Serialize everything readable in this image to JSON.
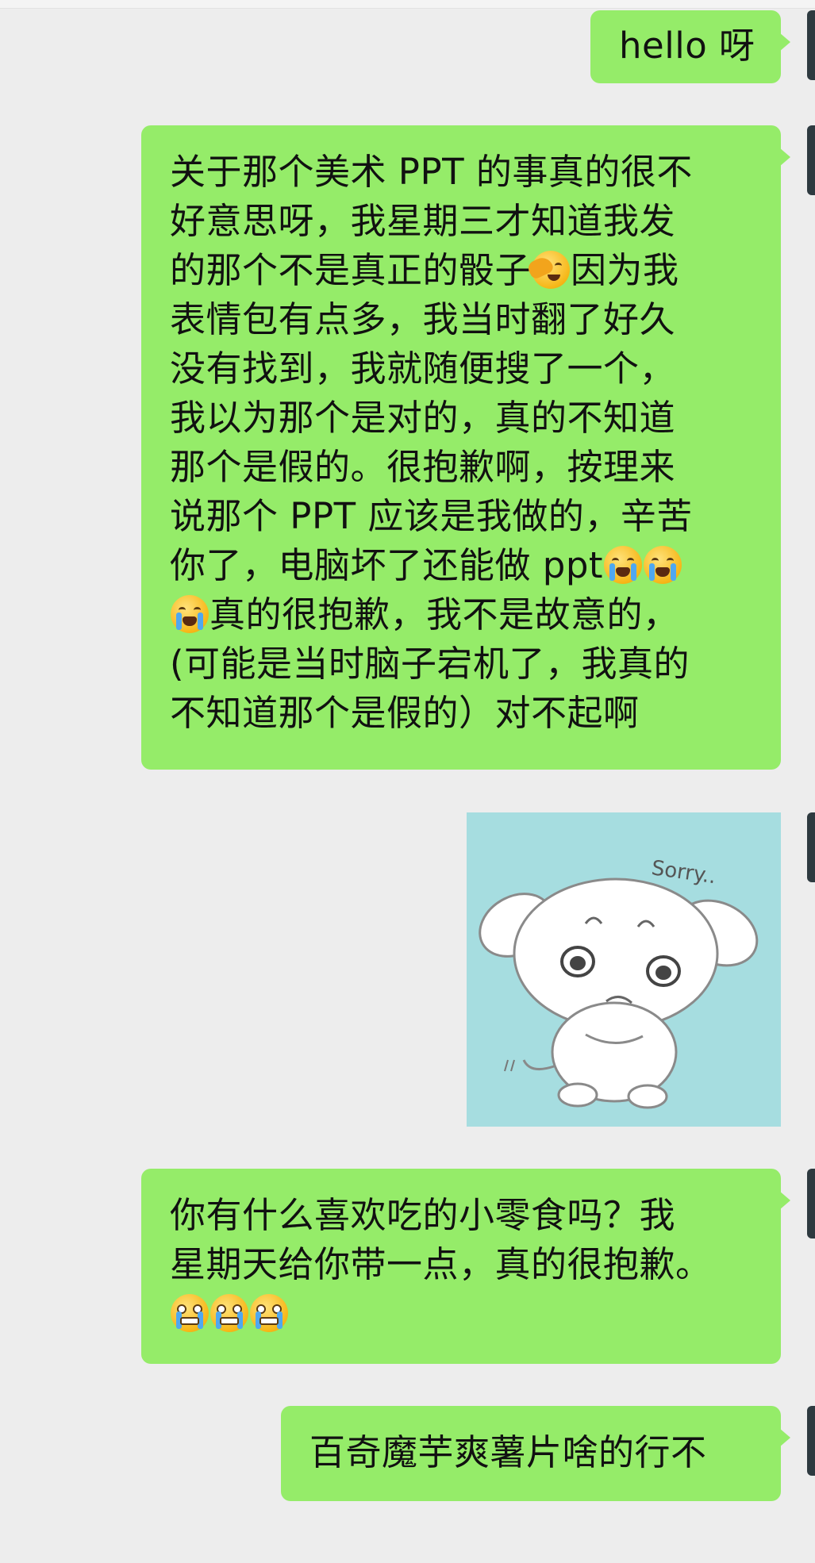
{
  "messages": [
    {
      "type": "text",
      "text": "hello 呀"
    },
    {
      "type": "rich",
      "lines": [
        "关于那个美术 PPT 的事真的很不",
        "好意思呀，我星期三才知道我发",
        "的那个不是真正的骰子",
        "表情包有点多，我当时翻了好久",
        "没有找到，我就随便搜了一个，",
        "我以为那个是对的，真的不知道",
        "那个是假的。很抱歉啊，按理来",
        "说那个 PPT 应该是我做的，辛苦",
        "你了，电脑坏了还能做 ppt",
        "真的很抱歉，我不是故意的，",
        "(可能是当时脑子宕机了，我真的",
        "不知道那个是假的）对不起啊"
      ],
      "line3_tail": "因为我",
      "emojis": [
        "facepalm-emoji",
        "crying-emoji",
        "crying-emoji",
        "crying-emoji"
      ]
    },
    {
      "type": "sticker",
      "caption": "Sorry..",
      "icon": "sorry-puppy-sticker"
    },
    {
      "type": "text",
      "lines": [
        "你有什么喜欢吃的小零食吗？我",
        "星期天给你带一点，真的很抱歉。"
      ],
      "emojis": [
        "grimace-emoji",
        "grimace-emoji",
        "grimace-emoji"
      ]
    },
    {
      "type": "text",
      "text": "百奇魔芋爽薯片啥的行不"
    }
  ],
  "colors": {
    "background": "#ededed",
    "self_bubble": "#95ec69",
    "sticker_bg": "#a6dde0"
  }
}
